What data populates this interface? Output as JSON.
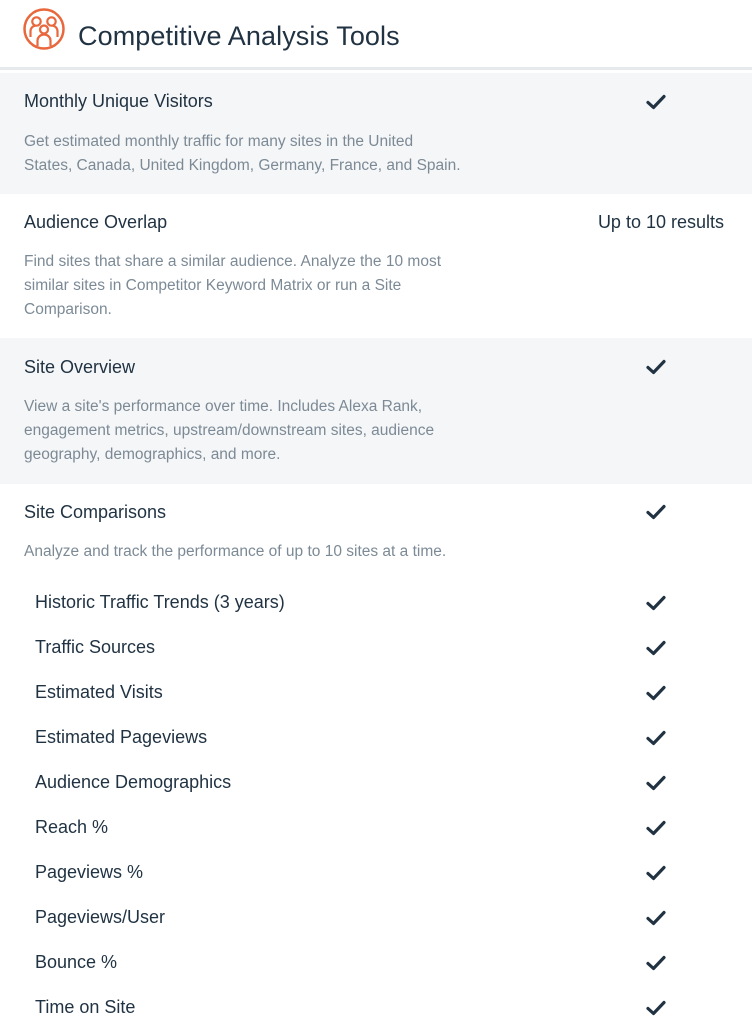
{
  "header": {
    "title": "Competitive Analysis Tools",
    "icon": "people-group-icon",
    "accent_color": "#e8673c"
  },
  "sections": [
    {
      "title": "Monthly Unique Visitors",
      "description_lines": [
        "Get estimated monthly traffic for many sites in the United",
        "States, Canada, United Kingdom, Germany, France, and Spain."
      ],
      "value": "check",
      "shaded": true
    },
    {
      "title": "Audience Overlap",
      "description_lines": [
        "Find sites that share a similar audience. Analyze the 10 most",
        "similar sites in Competitor Keyword Matrix or run a Site",
        "Comparison."
      ],
      "value": "Up to 10 results",
      "shaded": false
    },
    {
      "title": "Site Overview",
      "description_lines": [
        "View a site's performance over time. Includes Alexa Rank,",
        "engagement metrics, upstream/downstream sites, audience",
        "geography, demographics, and more."
      ],
      "value": "check",
      "shaded": true
    },
    {
      "title": "Site Comparisons",
      "description_lines": [
        "Analyze and track the performance of up to 10 sites at a time."
      ],
      "value": "check",
      "shaded": false
    }
  ],
  "site_comparison_features": [
    {
      "label": "Historic Traffic Trends (3 years)",
      "value": "check"
    },
    {
      "label": "Traffic Sources",
      "value": "check"
    },
    {
      "label": "Estimated Visits",
      "value": "check"
    },
    {
      "label": "Estimated Pageviews",
      "value": "check"
    },
    {
      "label": "Audience Demographics",
      "value": "check"
    },
    {
      "label": "Reach %",
      "value": "check"
    },
    {
      "label": "Pageviews %",
      "value": "check"
    },
    {
      "label": "Pageviews/User",
      "value": "check"
    },
    {
      "label": "Bounce %",
      "value": "check"
    },
    {
      "label": "Time on Site",
      "value": "check"
    }
  ]
}
